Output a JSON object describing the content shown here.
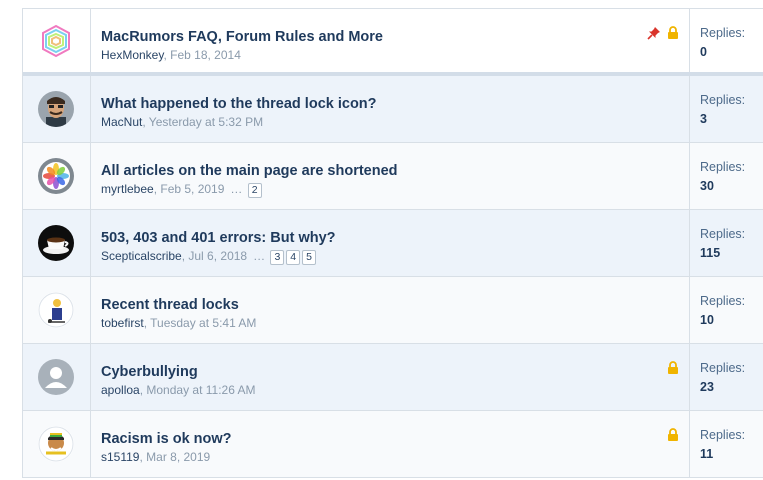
{
  "replies_label": "Replies:",
  "threads": [
    {
      "title": "MacRumors FAQ, Forum Rules and More",
      "user": "HexMonkey",
      "date": "Feb 18, 2014",
      "replies": "0",
      "pinned": true,
      "locked": true,
      "pages": []
    },
    {
      "title": "What happened to the thread lock icon?",
      "user": "MacNut",
      "date": "Yesterday at 5:32 PM",
      "replies": "3",
      "pinned": false,
      "locked": false,
      "pages": []
    },
    {
      "title": "All articles on the main page are shortened",
      "user": "myrtlebee",
      "date": "Feb 5, 2019",
      "replies": "30",
      "pinned": false,
      "locked": false,
      "pages": [
        "2"
      ]
    },
    {
      "title": "503, 403 and 401 errors: But why?",
      "user": "Scepticalscribe",
      "date": "Jul 6, 2018",
      "replies": "115",
      "pinned": false,
      "locked": false,
      "pages": [
        "3",
        "4",
        "5"
      ]
    },
    {
      "title": "Recent thread locks",
      "user": "tobefirst",
      "date": "Tuesday at 5:41 AM",
      "replies": "10",
      "pinned": false,
      "locked": false,
      "pages": []
    },
    {
      "title": "Cyberbullying",
      "user": "apolloa",
      "date": "Monday at 11:26 AM",
      "replies": "23",
      "pinned": false,
      "locked": true,
      "pages": []
    },
    {
      "title": "Racism is ok now?",
      "user": "s15119",
      "date": "Mar 8, 2019",
      "replies": "11",
      "pinned": false,
      "locked": true,
      "pages": []
    }
  ],
  "ellipsis": "…",
  "colors": {
    "pin": "#d9342b",
    "lock": "#f0b400",
    "title": "#1f3a5c",
    "alt_row": "#edf3fa"
  }
}
